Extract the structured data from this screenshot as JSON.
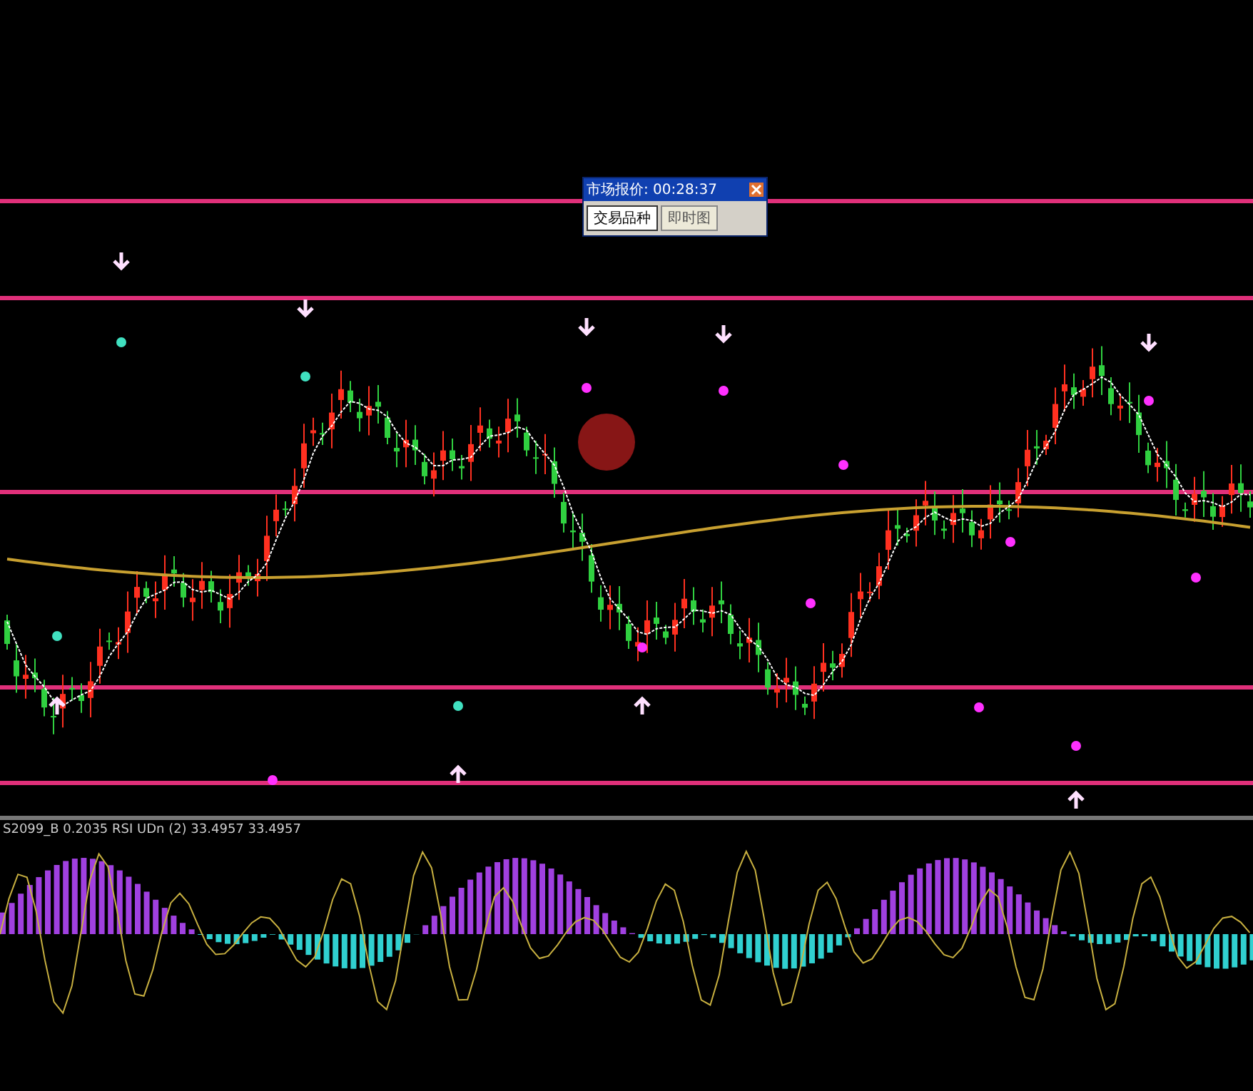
{
  "quote_window": {
    "title": "市场报价: 00:28:37",
    "tabs": [
      {
        "label": "交易品种",
        "selected": true
      },
      {
        "label": "即时图",
        "selected": false
      }
    ]
  },
  "indicator_pane": {
    "label": "S2099_B 0.2035 RSI UDn (2) 33.4957 33.4957"
  }
}
